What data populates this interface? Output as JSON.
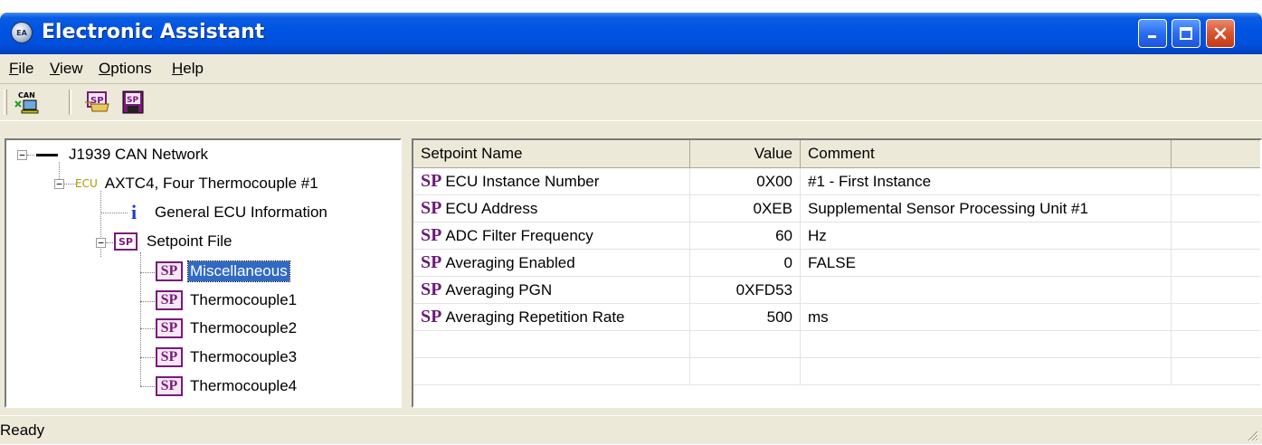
{
  "window": {
    "title": "Electronic Assistant"
  },
  "menu": [
    {
      "label": "File",
      "underline": "F",
      "rest": "ile"
    },
    {
      "label": "View",
      "underline": "V",
      "rest": "iew"
    },
    {
      "label": "Options",
      "underline": "O",
      "rest": "ptions"
    },
    {
      "label": "Help",
      "underline": "H",
      "rest": "elp"
    }
  ],
  "toolbar": {
    "can_label": "CAN",
    "sp_label": "SP"
  },
  "tree": {
    "network": "J1939 CAN Network",
    "ecu_tag": "ECU",
    "ecu": "AXTC4, Four Thermocouple #1",
    "general": "General ECU Information",
    "setpoint_file": "Setpoint File",
    "sp_tag": "SP",
    "sp_file_tag": "SP",
    "groups": [
      "Miscellaneous",
      "Thermocouple1",
      "Thermocouple2",
      "Thermocouple3",
      "Thermocouple4"
    ]
  },
  "table": {
    "headers": {
      "name": "Setpoint Name",
      "value": "Value",
      "comment": "Comment"
    },
    "sp_tag": "SP",
    "rows": [
      {
        "name": "ECU Instance Number",
        "value": "0X00",
        "comment": "#1 - First Instance"
      },
      {
        "name": "ECU Address",
        "value": "0XEB",
        "comment": "Supplemental Sensor Processing Unit #1"
      },
      {
        "name": "ADC Filter Frequency",
        "value": "60",
        "comment": "Hz"
      },
      {
        "name": "Averaging Enabled",
        "value": "0",
        "comment": "FALSE"
      },
      {
        "name": "Averaging PGN",
        "value": "0XFD53",
        "comment": ""
      },
      {
        "name": "Averaging Repetition Rate",
        "value": "500",
        "comment": "ms"
      }
    ]
  },
  "status": {
    "text": "Ready"
  },
  "colors": {
    "title_blue": "#0054e3",
    "selection": "#316ac5",
    "sp_purple": "#6b1a7a"
  }
}
